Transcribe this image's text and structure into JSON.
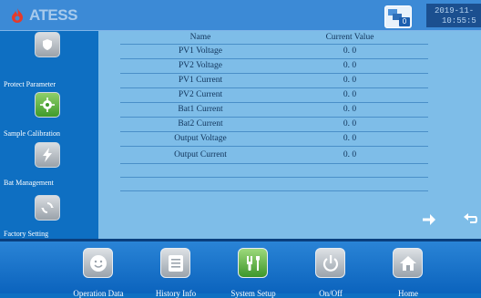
{
  "header": {
    "logo_text": "ATESS",
    "comm_count": "0",
    "date": "2019-11-",
    "time": "10:55:5"
  },
  "sidebar": {
    "items": [
      {
        "label": "Protect Parameter",
        "icon": "shield-icon",
        "active": false
      },
      {
        "label": "Sample Calibration",
        "icon": "crosshair-icon",
        "active": true
      },
      {
        "label": "Bat Management",
        "icon": "lightning-icon",
        "active": false
      },
      {
        "label": "Factory Setting",
        "icon": "refresh-icon",
        "active": false
      }
    ]
  },
  "table": {
    "headers": {
      "name": "Name",
      "value": "Current Value"
    },
    "rows": [
      {
        "name": "PV1 Voltage",
        "value": "0. 0"
      },
      {
        "name": "PV2 Voltage",
        "value": "0. 0"
      },
      {
        "name": "PV1 Current",
        "value": "0. 0"
      },
      {
        "name": "PV2 Current",
        "value": "0. 0"
      },
      {
        "name": "Bat1 Current",
        "value": "0. 0"
      },
      {
        "name": "Bat2 Current",
        "value": "0. 0"
      },
      {
        "name": "Output Voltage",
        "value": "0. 0"
      },
      {
        "name": "Output Current",
        "value": "0. 0"
      }
    ]
  },
  "bottom_nav": {
    "items": [
      {
        "label": "Operation Data",
        "icon": "smiley-icon",
        "active": false
      },
      {
        "label": "History Info",
        "icon": "document-icon",
        "active": false
      },
      {
        "label": "System Setup",
        "icon": "tools-icon",
        "active": true
      },
      {
        "label": "On/Off",
        "icon": "power-icon",
        "active": false
      },
      {
        "label": "Home",
        "icon": "home-icon",
        "active": false
      }
    ]
  },
  "colors": {
    "accent_green": "#3f9a2a",
    "panel_blue": "#7ebde8",
    "bar_blue": "#0e6fc2",
    "logo_red": "#e53a2a"
  }
}
